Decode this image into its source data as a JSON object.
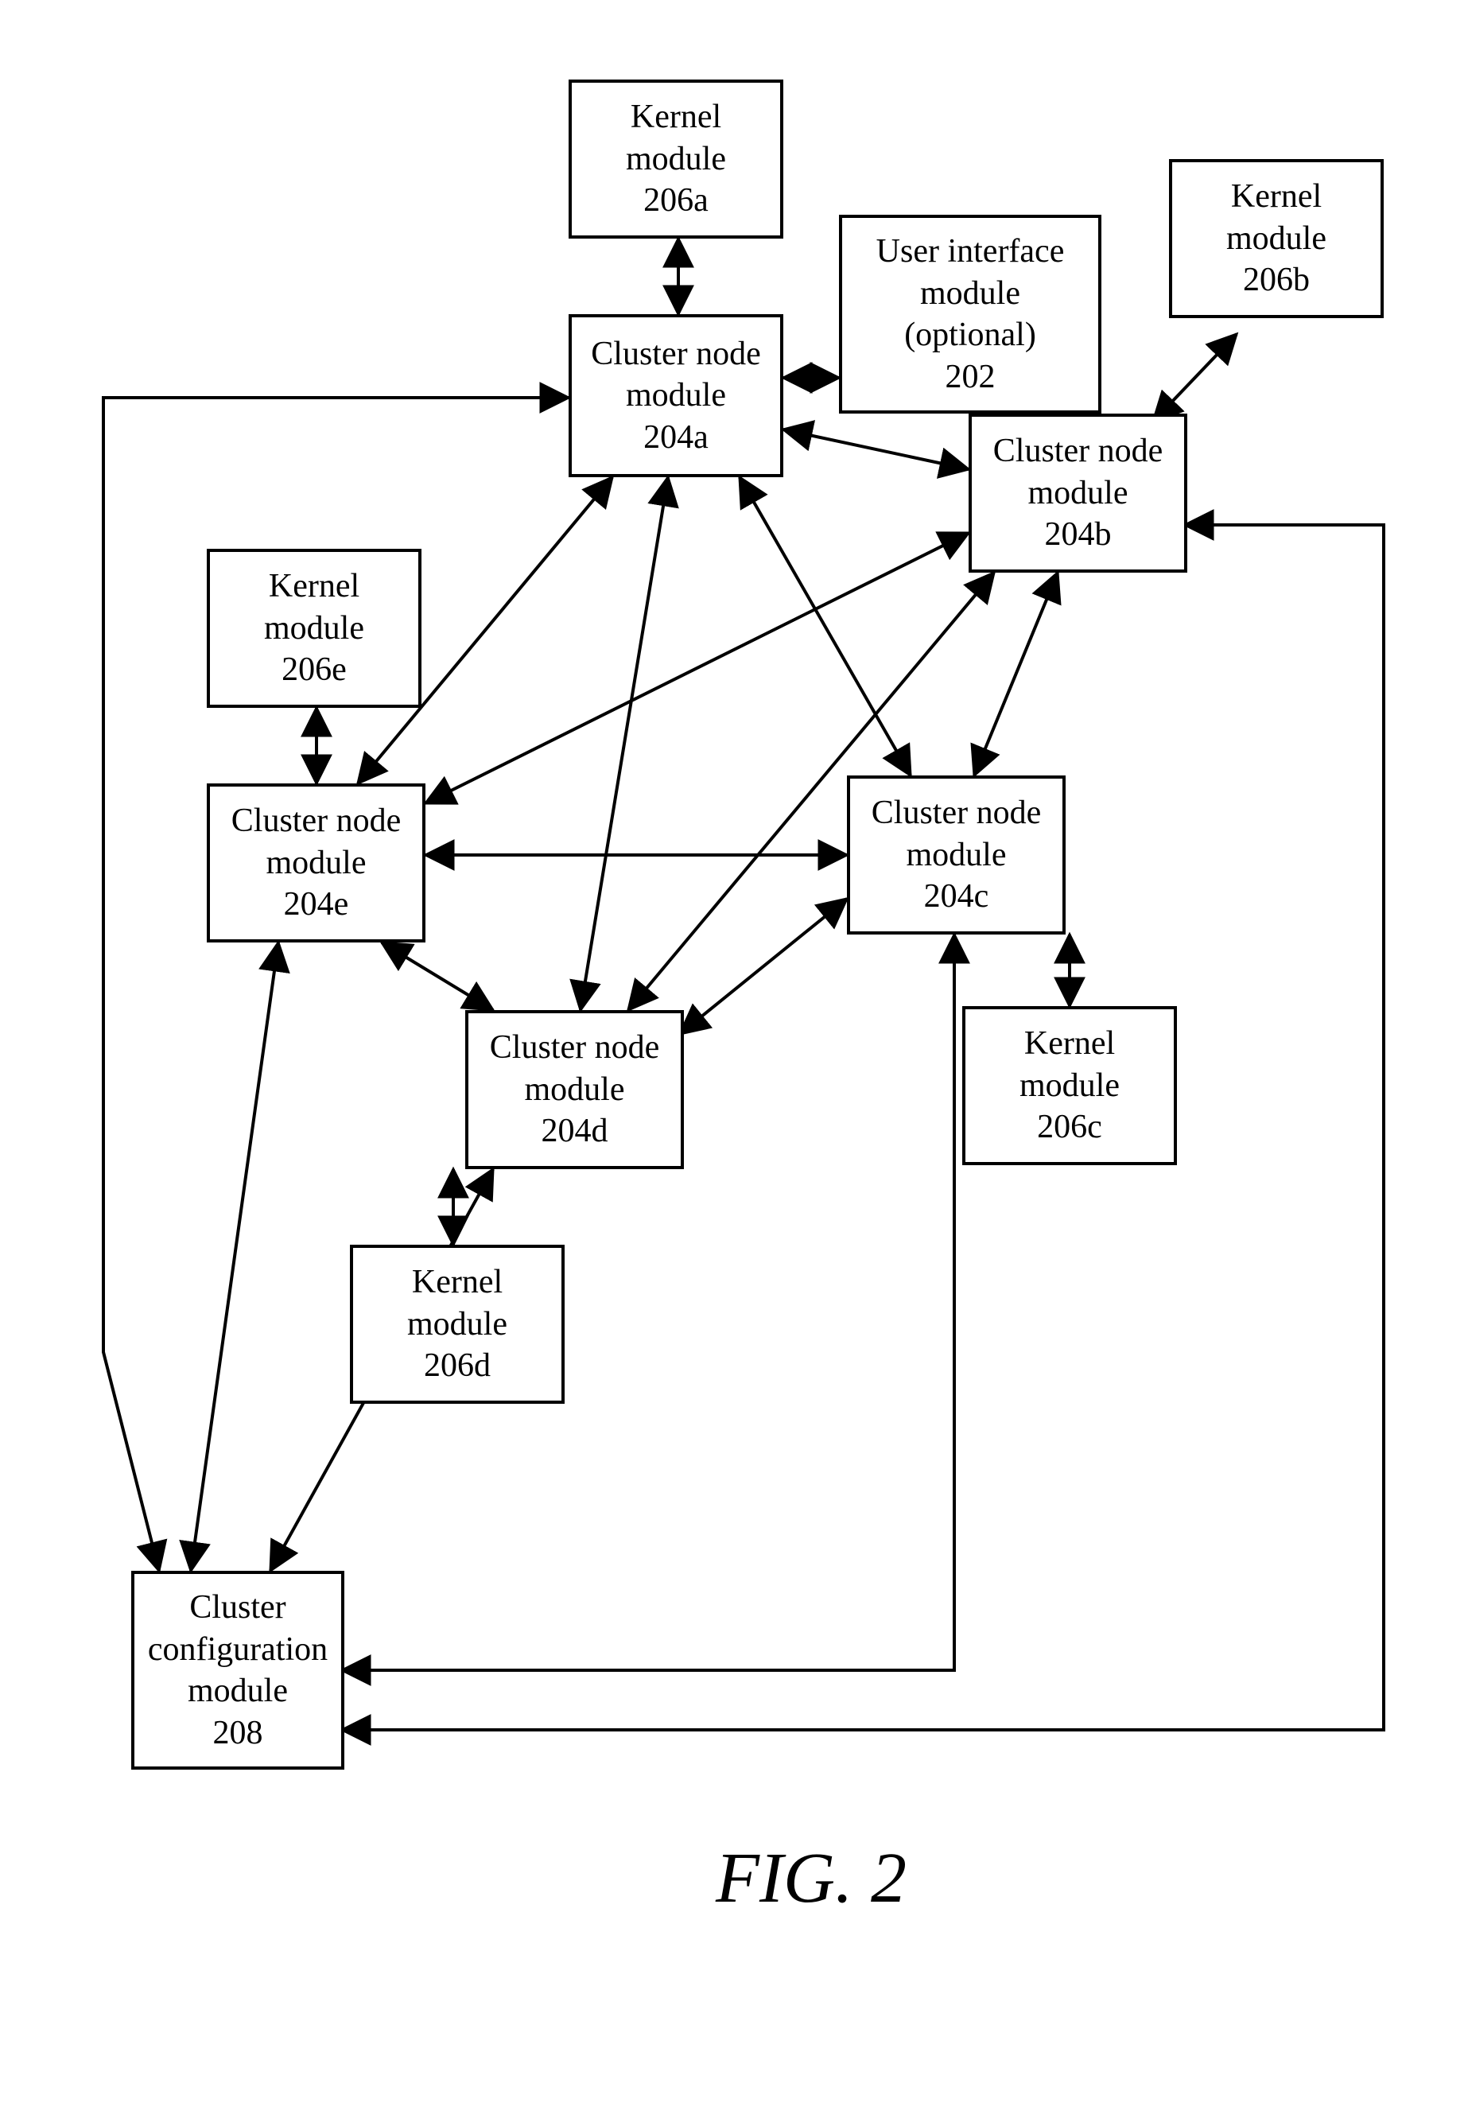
{
  "caption": "FIG. 2",
  "boxes": {
    "ui": {
      "l1": "User interface",
      "l2": "module",
      "l3": "(optional)",
      "l4": "202"
    },
    "k_a": {
      "l1": "Kernel",
      "l2": "module",
      "l3": "206a"
    },
    "k_b": {
      "l1": "Kernel",
      "l2": "module",
      "l3": "206b"
    },
    "k_c": {
      "l1": "Kernel",
      "l2": "module",
      "l3": "206c"
    },
    "k_d": {
      "l1": "Kernel",
      "l2": "module",
      "l3": "206d"
    },
    "k_e": {
      "l1": "Kernel",
      "l2": "module",
      "l3": "206e"
    },
    "c_a": {
      "l1": "Cluster node",
      "l2": "module",
      "l3": "204a"
    },
    "c_b": {
      "l1": "Cluster node",
      "l2": "module",
      "l3": "204b"
    },
    "c_c": {
      "l1": "Cluster node",
      "l2": "module",
      "l3": "204c"
    },
    "c_d": {
      "l1": "Cluster node",
      "l2": "module",
      "l3": "204d"
    },
    "c_e": {
      "l1": "Cluster node",
      "l2": "module",
      "l3": "204e"
    },
    "cfg": {
      "l1": "Cluster",
      "l2": "configuration",
      "l3": "module",
      "l4": "208"
    }
  }
}
